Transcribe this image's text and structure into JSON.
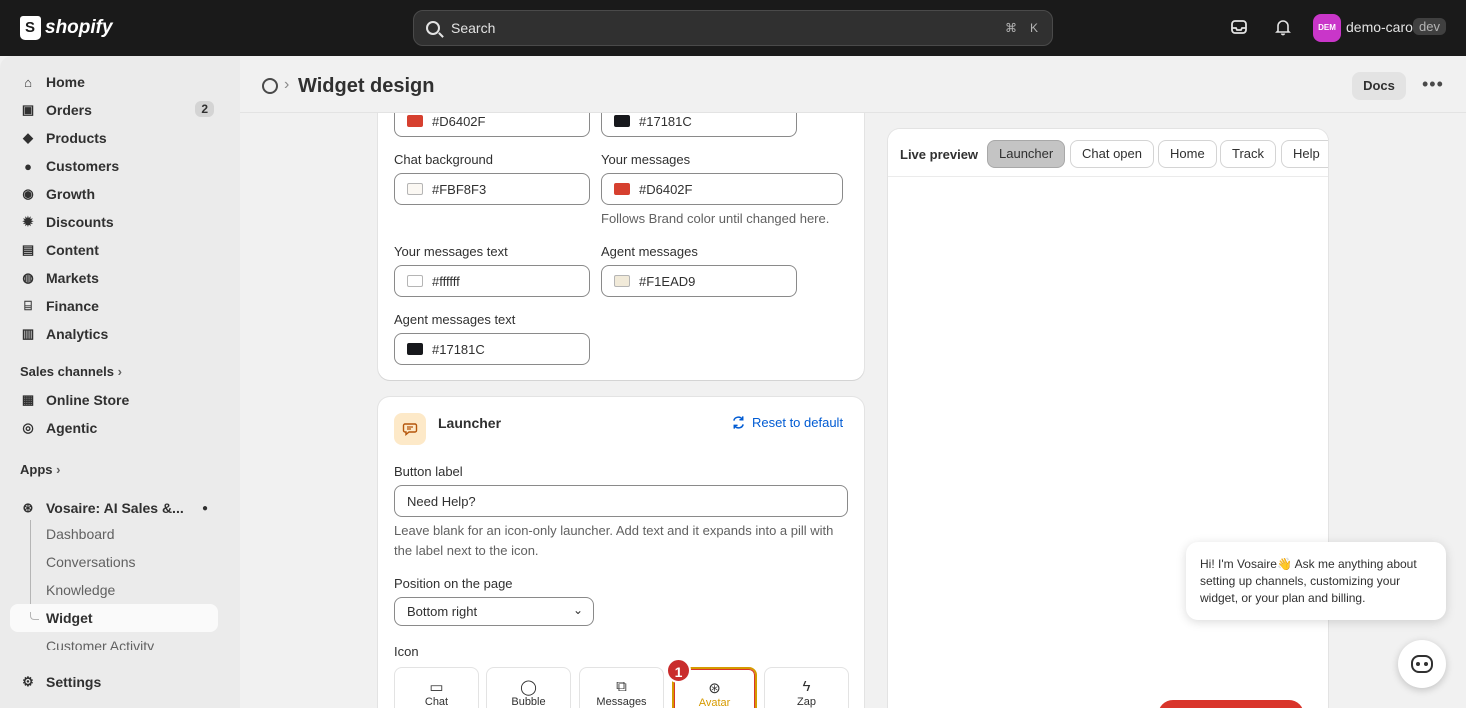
{
  "topbar": {
    "logo_text": "shopify",
    "search_placeholder": "Search",
    "kbd_cmd": "⌘",
    "kbd_key": "K",
    "avatar_initials": "DEM",
    "store_name": "demo-caro",
    "env_badge": "dev"
  },
  "sidebar": {
    "items": [
      {
        "label": "Home",
        "icon": "home-icon"
      },
      {
        "label": "Orders",
        "icon": "orders-icon",
        "count": "2"
      },
      {
        "label": "Products",
        "icon": "tag-icon"
      },
      {
        "label": "Customers",
        "icon": "person-icon"
      },
      {
        "label": "Growth",
        "icon": "growth-icon"
      },
      {
        "label": "Discounts",
        "icon": "discount-icon"
      },
      {
        "label": "Content",
        "icon": "content-icon"
      },
      {
        "label": "Markets",
        "icon": "globe-icon"
      },
      {
        "label": "Finance",
        "icon": "bank-icon"
      },
      {
        "label": "Analytics",
        "icon": "chart-icon"
      }
    ],
    "sales_channels_label": "Sales channels",
    "channels": [
      {
        "label": "Online Store",
        "icon": "store-icon"
      },
      {
        "label": "Agentic",
        "icon": "agentic-icon"
      }
    ],
    "apps_label": "Apps",
    "app_name": "Vosaire: AI Sales &...",
    "app_sub": [
      "Dashboard",
      "Conversations",
      "Knowledge",
      "Widget",
      "Customer Activity"
    ],
    "settings_label": "Settings"
  },
  "header": {
    "title": "Widget design",
    "docs_label": "Docs"
  },
  "colors_card": {
    "top_left_value": "#D6402F",
    "top_right_value": "#17181C",
    "chat_background_label": "Chat background",
    "chat_background_value": "#FBF8F3",
    "your_messages_label": "Your messages",
    "your_messages_value": "#D6402F",
    "your_messages_help": "Follows Brand color until changed here.",
    "your_messages_text_label": "Your messages text",
    "your_messages_text_value": "#ffffff",
    "agent_messages_label": "Agent messages",
    "agent_messages_value": "#F1EAD9",
    "agent_messages_text_label": "Agent messages text",
    "agent_messages_text_value": "#17181C"
  },
  "launcher_card": {
    "title": "Launcher",
    "reset_label": "Reset to default",
    "button_label_label": "Button label",
    "button_label_value": "Need Help?",
    "button_label_help": "Leave blank for an icon-only launcher. Add text and it expands into a pill with the label next to the icon.",
    "position_label": "Position on the page",
    "position_value": "Bottom right",
    "icon_label": "Icon",
    "icon_options": [
      "Chat",
      "Bubble",
      "Messages",
      "Avatar",
      "Zap"
    ],
    "selected_badge": "1"
  },
  "preview": {
    "title": "Live preview",
    "tabs": [
      "Launcher",
      "Chat open",
      "Home",
      "Track",
      "Help"
    ],
    "bubble_line1": "Hi! I'm Vosaire",
    "bubble_emoji": "👋",
    "bubble_rest": " Ask me anything about setting up channels, customizing your widget, or your plan and billing."
  },
  "swatches": {
    "red": "#D6402F",
    "dark": "#17181C",
    "cream": "#FBF8F3",
    "white": "#ffffff",
    "beige": "#F1EAD9"
  }
}
